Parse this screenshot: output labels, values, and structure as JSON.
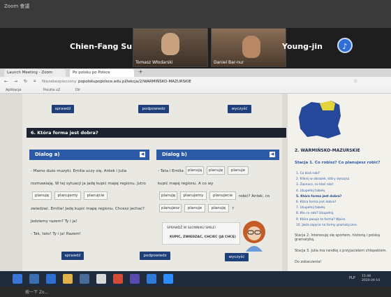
{
  "zoom": {
    "title": "Zoom 會議",
    "participants": [
      {
        "name": "Chien-Fang Su"
      },
      {
        "name": "Tomasz Włodarski"
      },
      {
        "name": "Daniel Bar-nur"
      },
      {
        "name": "Young-jin"
      }
    ]
  },
  "browser": {
    "tabs": [
      "Launch Meeting - Zoom",
      "Po polsku po Polsce"
    ],
    "url_security": "Niezabezpieczony",
    "url": "popolskupopolsce.edu.pl/lekcja/2/WARMIŃSKO-MAZURSKIE",
    "bookmarks": [
      "Aplikacje",
      "Poczta u2",
      "Dir"
    ]
  },
  "exercise": {
    "top_buttons": {
      "check": "sprawdź",
      "hint": "podpowiedz",
      "clear": "wyczyść"
    },
    "header": "6. Która forma jest dobra?",
    "dialog_a": {
      "title": "Dialog a)",
      "line1": "- Mamo dużo muzyki. Emilia uczy się, Antek i Julia",
      "line2": "rozmawiają. W tej sytuacji ja jadę kupić mapę regionu. Jutro",
      "options1": [
        "planuję",
        "planujemy",
        "planujcie"
      ],
      "line3": "zwiedzać. Emilia! Jadę kupić mapę regionu. Chcesz jechać?",
      "line4": "Jedziemy razem? Ty i ja!",
      "line5": "- Tak, tato! Ty i ja! Razem!"
    },
    "dialog_b": {
      "title": "Dialog b)",
      "line1_prefix": "- Tata i Emilia",
      "options1": [
        "planują",
        "planuję",
        "planuje"
      ],
      "line2": "kupić mapę regionu. A co wy",
      "options2": [
        "planuję",
        "planujemy",
        "planujecie"
      ],
      "line2_suffix": "robić? Antek, co",
      "options3": [
        "planujesz",
        "planuje",
        "planuję"
      ],
      "line3_suffix": "?"
    },
    "tip": {
      "line1": "SPRAWDŹ W SŁOWNIKU SMILE!",
      "line2": "KUPIĆ, ZWIEDZAĆ, CHCIEĆ (JA CHCĘ)"
    },
    "bottom_buttons": {
      "check": "sprawdź",
      "hint": "podpowiedz",
      "clear": "wyczyść"
    }
  },
  "sidebar": {
    "title": "2. WARMIŃSKO-MAZURSKIE",
    "station": "Stacja 1. Co robisz? Co planujesz robić?",
    "items": [
      "1. Co ktoś robi?",
      "2. Kliknij w obrazek, który słyszysz.",
      "3. Zaznacz, co ktoś robi!",
      "4. Uzupełnij tabelę.",
      "5. Która forma jest dobra?",
      "6. Która forma jest dobra?",
      "7. Uzupełnij tabelę.",
      "8. Kto co robi? Uzupełnij.",
      "9. Która pasuje ta forma? Wpisz.",
      "10. Jakie zajęcia na formy gramatyczne."
    ],
    "active_index": 4,
    "stations": [
      "Stacja 2. Interesuję się sportem, historią i polską gramatyką.",
      "Stacja 3. Julia ma randkę z przyjacielem chłopakiem.",
      "Do zobaczenia!"
    ]
  },
  "taskbar": {
    "lang": "PLP",
    "time": "15:48",
    "date": "2020-04-14"
  },
  "bottom_text": "按一下 Zo..."
}
